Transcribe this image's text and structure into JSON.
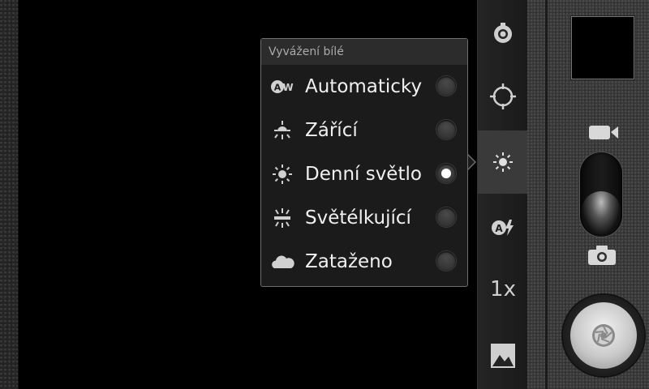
{
  "popup": {
    "title": "Vyvážení bílé",
    "options": [
      {
        "label": "Automaticky",
        "icon": "auto-wb-icon",
        "selected": false
      },
      {
        "label": "Zářící",
        "icon": "incandescent-icon",
        "selected": false
      },
      {
        "label": "Denní světlo",
        "icon": "daylight-icon",
        "selected": true
      },
      {
        "label": "Světélkující",
        "icon": "fluorescent-icon",
        "selected": false
      },
      {
        "label": "Zataženo",
        "icon": "cloudy-icon",
        "selected": false
      }
    ]
  },
  "settings_bar": {
    "items": [
      {
        "icon": "camera-settings-icon"
      },
      {
        "icon": "focus-icon"
      },
      {
        "icon": "white-balance-icon",
        "active": true
      },
      {
        "icon": "auto-flash-icon"
      },
      {
        "icon": "zoom-icon",
        "label": "1x"
      },
      {
        "icon": "gallery-icon"
      }
    ]
  },
  "controls": {
    "mode_switch": {
      "video_icon": "video-camera-icon",
      "photo_icon": "photo-camera-icon",
      "selected": "photo"
    },
    "shutter_icon": "shutter-icon"
  },
  "colors": {
    "accent": "#ffffff",
    "popup_bg": "#1b1b1b",
    "popup_border": "#6e6e6e",
    "bar_selected": "#3a3a3a"
  }
}
